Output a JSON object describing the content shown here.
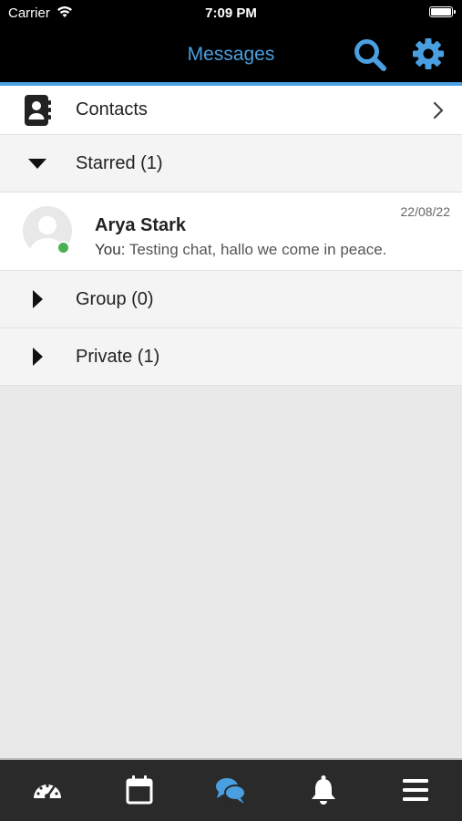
{
  "status_bar": {
    "carrier": "Carrier",
    "time": "7:09 PM"
  },
  "header": {
    "title": "Messages"
  },
  "list": {
    "contacts_label": "Contacts",
    "starred_label": "Starred (1)",
    "group_label": "Group (0)",
    "private_label": "Private (1)"
  },
  "chat": {
    "name": "Arya Stark",
    "sender_prefix": "You:",
    "message": " Testing chat, hallo we come in peace.",
    "date": "22/08/22",
    "online": true
  },
  "icons": {
    "search": "search-icon",
    "settings": "gear-icon",
    "contacts": "contact-book-icon",
    "tabs": [
      "speedometer-icon",
      "calendar-icon",
      "chat-bubbles-icon",
      "bell-icon",
      "menu-icon"
    ]
  },
  "colors": {
    "accent": "#4a9fe0",
    "online": "#4cb052",
    "tabbar_bg": "#2a2a2a",
    "header_bg": "#000000"
  }
}
